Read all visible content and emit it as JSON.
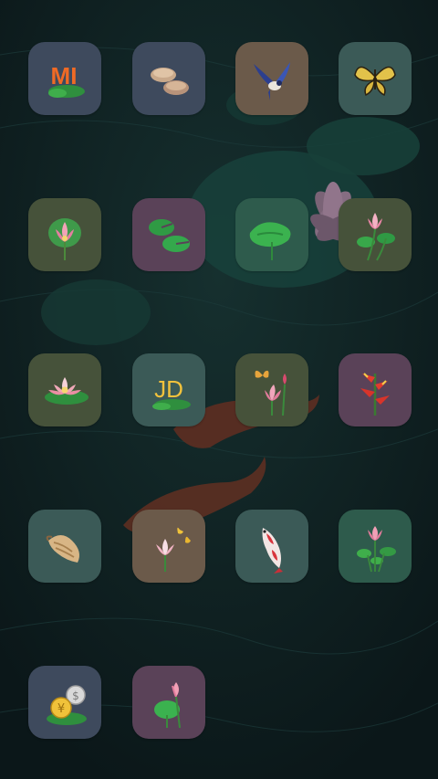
{
  "screen": {
    "background_color": "#0f1f21",
    "tile_colors": {
      "slate": "#3e4a5d",
      "brown": "#6b5a4a",
      "teal": "#3b5a57",
      "olive": "#46523a",
      "mauve": "#5a4258",
      "green": "#2e5b4c"
    }
  },
  "apps": [
    {
      "id": "mi",
      "icon": "mi-logo-icon",
      "logo_text": "MI"
    },
    {
      "id": "stones",
      "icon": "pebbles-icon"
    },
    {
      "id": "swallow",
      "icon": "swallow-bird-icon"
    },
    {
      "id": "butterfly",
      "icon": "butterfly-icon"
    },
    {
      "id": "lotus-leaf",
      "icon": "lotus-on-leaf-icon"
    },
    {
      "id": "lily-pads",
      "icon": "lily-pads-icon"
    },
    {
      "id": "green-leaf",
      "icon": "lotus-leaf-icon"
    },
    {
      "id": "pink-lotus",
      "icon": "pink-lotus-icon"
    },
    {
      "id": "water-lily",
      "icon": "water-lily-icon"
    },
    {
      "id": "jd",
      "icon": "jd-logo-icon",
      "logo_text": "JD"
    },
    {
      "id": "lotus-butterfly",
      "icon": "lotus-butterfly-icon"
    },
    {
      "id": "heliconia",
      "icon": "heliconia-flower-icon"
    },
    {
      "id": "shell",
      "icon": "seashell-icon"
    },
    {
      "id": "lotus-butterflies",
      "icon": "lotus-butterflies-icon"
    },
    {
      "id": "koi",
      "icon": "koi-fish-icon"
    },
    {
      "id": "lotus-plant",
      "icon": "lotus-plant-icon"
    },
    {
      "id": "coins",
      "icon": "coins-icon",
      "coin_symbols": [
        "¥",
        "$"
      ]
    },
    {
      "id": "lotus-bud",
      "icon": "lotus-bud-icon"
    }
  ]
}
